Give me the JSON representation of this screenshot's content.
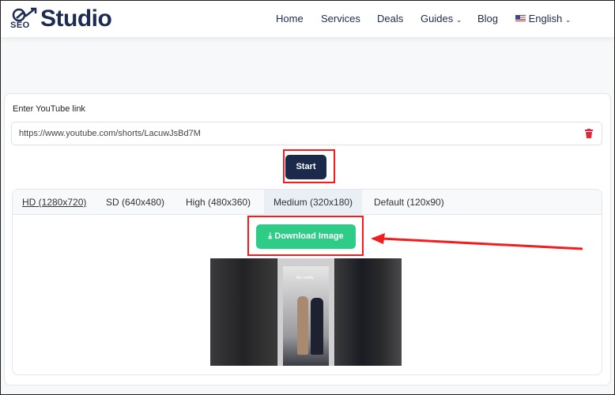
{
  "header": {
    "logo_small": "SEO",
    "logo_text": "Studio",
    "nav": [
      {
        "label": "Home"
      },
      {
        "label": "Services"
      },
      {
        "label": "Deals"
      },
      {
        "label": "Guides"
      },
      {
        "label": "Blog"
      },
      {
        "label": "English"
      }
    ]
  },
  "form": {
    "label": "Enter YouTube link",
    "value": "https://www.youtube.com/shorts/LacuwJsBd7M",
    "start_label": "Start"
  },
  "tabs": [
    {
      "label": "HD (1280x720)"
    },
    {
      "label": "SD (640x480)"
    },
    {
      "label": "High (480x360)"
    },
    {
      "label": "Medium (320x180)",
      "active": true
    },
    {
      "label": "Default (120x90)"
    }
  ],
  "download_label": "Download Image",
  "thumbnail_caption": "Me reality",
  "colors": {
    "brand": "#1d2b53",
    "start": "#1b2a4a",
    "download": "#2ecc87",
    "highlight": "#f21d1d",
    "trash": "#e0283a"
  }
}
